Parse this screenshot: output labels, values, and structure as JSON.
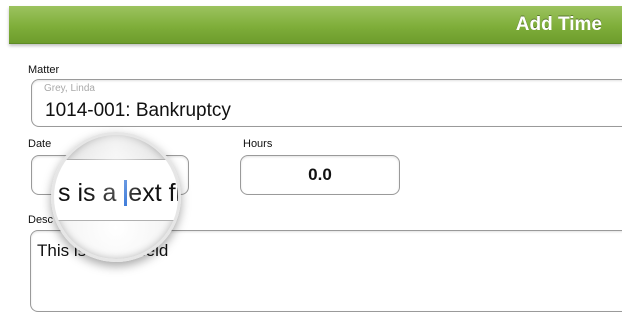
{
  "header": {
    "title": "Add Time"
  },
  "matter": {
    "label": "Matter",
    "client": "Grey, Linda",
    "value": "1014-001: Bankruptcy"
  },
  "date": {
    "label": "Date"
  },
  "hours": {
    "label": "Hours",
    "value": "0.0"
  },
  "description": {
    "label": "Desc",
    "value": "This is a text field"
  },
  "magnifier": {
    "text_before": "s is a ",
    "text_after": "ext fi"
  }
}
